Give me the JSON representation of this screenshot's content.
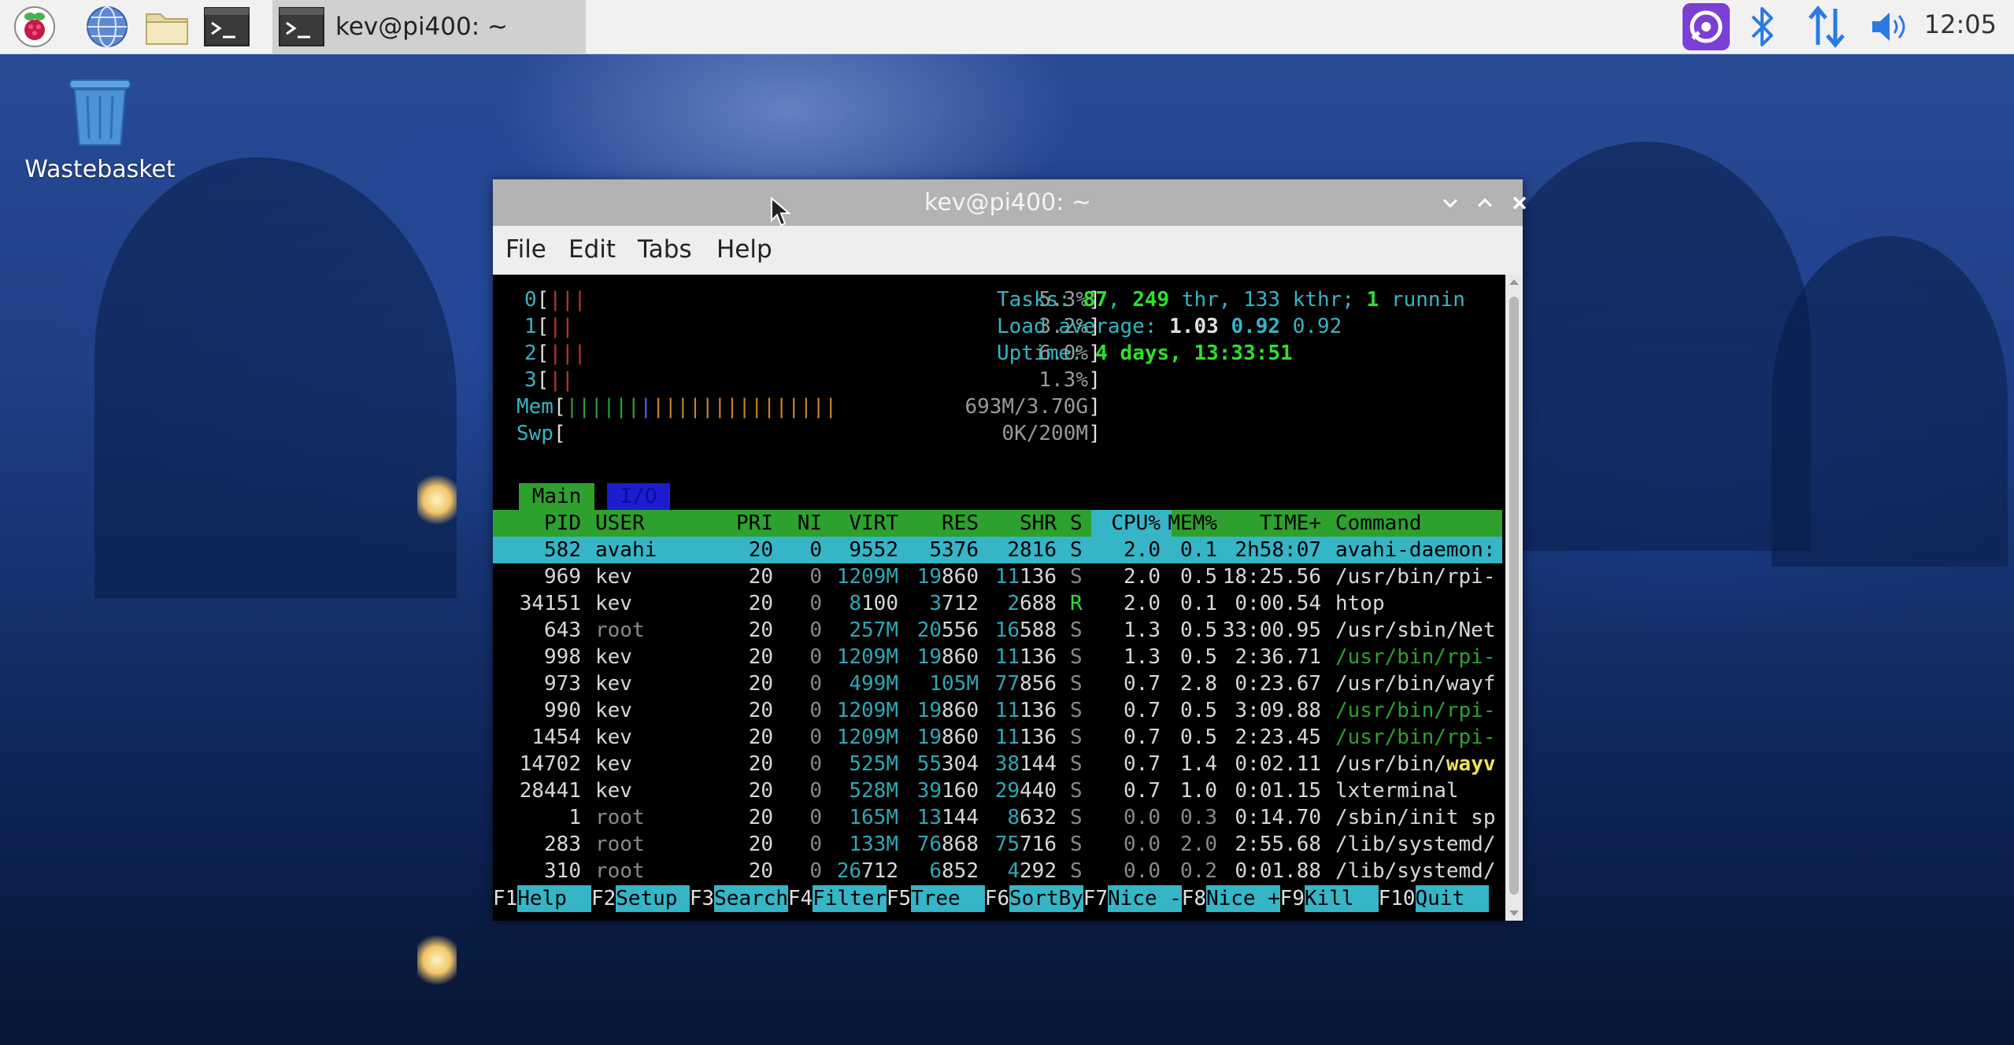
{
  "taskbar": {
    "launchers": [
      "raspberry-menu",
      "web-browser",
      "file-manager",
      "terminal"
    ],
    "task_title": "kev@pi400: ~",
    "clock": "12:05"
  },
  "desktop": {
    "wastebasket_label": "Wastebasket"
  },
  "window": {
    "title": "kev@pi400: ~",
    "menu": [
      "File",
      "Edit",
      "Tabs",
      "Help"
    ]
  },
  "htop": {
    "cpus": [
      {
        "label": "0",
        "bar": "|||",
        "pct": "5.3%"
      },
      {
        "label": "1",
        "bar": "||",
        "pct": "3.2%"
      },
      {
        "label": "2",
        "bar": "|||",
        "pct": "6.0%"
      },
      {
        "label": "3",
        "bar": "||",
        "pct": "1.3%"
      }
    ],
    "mem": {
      "label": "Mem",
      "value": "693M/3.70G"
    },
    "swp": {
      "label": "Swp",
      "value": "0K/200M"
    },
    "tasks": {
      "label": "Tasks:",
      "count": "87",
      "thr": "249",
      "thr_label": "thr,",
      "kthr": "133 kthr;",
      "running": "1",
      "running_label": "runnin"
    },
    "load": {
      "label": "Load average:",
      "v1": "1.03",
      "v5": "0.92",
      "v15": "0.92"
    },
    "uptime": {
      "label": "Uptime:",
      "value": "4 days, 13:33:51"
    },
    "tabs": {
      "main": "Main",
      "io": "I/O"
    },
    "headers": {
      "pid": "PID",
      "user": "USER",
      "pri": "PRI",
      "ni": "NI",
      "virt": "VIRT",
      "res": "RES",
      "shr": "SHR",
      "s": "S",
      "cpu": "CPU%",
      "mem": "MEM%",
      "time": "TIME+",
      "cmd": "Command"
    },
    "rows": [
      {
        "pid": "582",
        "user": "avahi",
        "pri": "20",
        "ni": "0",
        "virt": "9552",
        "res": "5376",
        "shr": "2816",
        "s": "S",
        "cpu": "2.0",
        "mem": "0.1",
        "time": "2h58:07",
        "cmd": "avahi-daemon:"
      },
      {
        "pid": "969",
        "user": "kev",
        "pri": "20",
        "ni": "0",
        "virt": "1209M",
        "res": "19860",
        "shr": "11136",
        "s": "S",
        "cpu": "2.0",
        "mem": "0.5",
        "time": "18:25.56",
        "cmd": "/usr/bin/rpi-"
      },
      {
        "pid": "34151",
        "user": "kev",
        "pri": "20",
        "ni": "0",
        "virt": "8100",
        "res": "3712",
        "shr": "2688",
        "s": "R",
        "cpu": "2.0",
        "mem": "0.1",
        "time": "0:00.54",
        "cmd": "htop"
      },
      {
        "pid": "643",
        "user": "root",
        "pri": "20",
        "ni": "0",
        "virt": "257M",
        "res": "20556",
        "shr": "16588",
        "s": "S",
        "cpu": "1.3",
        "mem": "0.5",
        "time": "33:00.95",
        "cmd": "/usr/sbin/Net"
      },
      {
        "pid": "998",
        "user": "kev",
        "pri": "20",
        "ni": "0",
        "virt": "1209M",
        "res": "19860",
        "shr": "11136",
        "s": "S",
        "cpu": "1.3",
        "mem": "0.5",
        "time": "2:36.71",
        "cmd": "/usr/bin/rpi-"
      },
      {
        "pid": "973",
        "user": "kev",
        "pri": "20",
        "ni": "0",
        "virt": "499M",
        "res": "105M",
        "shr": "77856",
        "s": "S",
        "cpu": "0.7",
        "mem": "2.8",
        "time": "0:23.67",
        "cmd": "/usr/bin/wayf"
      },
      {
        "pid": "990",
        "user": "kev",
        "pri": "20",
        "ni": "0",
        "virt": "1209M",
        "res": "19860",
        "shr": "11136",
        "s": "S",
        "cpu": "0.7",
        "mem": "0.5",
        "time": "3:09.88",
        "cmd": "/usr/bin/rpi-"
      },
      {
        "pid": "1454",
        "user": "kev",
        "pri": "20",
        "ni": "0",
        "virt": "1209M",
        "res": "19860",
        "shr": "11136",
        "s": "S",
        "cpu": "0.7",
        "mem": "0.5",
        "time": "2:23.45",
        "cmd": "/usr/bin/rpi-"
      },
      {
        "pid": "14702",
        "user": "kev",
        "pri": "20",
        "ni": "0",
        "virt": "525M",
        "res": "55304",
        "shr": "38144",
        "s": "S",
        "cpu": "0.7",
        "mem": "1.4",
        "time": "0:02.11",
        "cmd": "/usr/bin/wayv"
      },
      {
        "pid": "28441",
        "user": "kev",
        "pri": "20",
        "ni": "0",
        "virt": "528M",
        "res": "39160",
        "shr": "29440",
        "s": "S",
        "cpu": "0.7",
        "mem": "1.0",
        "time": "0:01.15",
        "cmd": "lxterminal"
      },
      {
        "pid": "1",
        "user": "root",
        "pri": "20",
        "ni": "0",
        "virt": "165M",
        "res": "13144",
        "shr": "8632",
        "s": "S",
        "cpu": "0.0",
        "mem": "0.3",
        "time": "0:14.70",
        "cmd": "/sbin/init sp"
      },
      {
        "pid": "283",
        "user": "root",
        "pri": "20",
        "ni": "0",
        "virt": "133M",
        "res": "76868",
        "shr": "75716",
        "s": "S",
        "cpu": "0.0",
        "mem": "2.0",
        "time": "2:55.68",
        "cmd": "/lib/systemd/"
      },
      {
        "pid": "310",
        "user": "root",
        "pri": "20",
        "ni": "0",
        "virt": "26712",
        "res": "6852",
        "shr": "4292",
        "s": "S",
        "cpu": "0.0",
        "mem": "0.2",
        "time": "0:01.88",
        "cmd": "/lib/systemd/"
      }
    ],
    "fkeys": [
      {
        "key": "F1",
        "label": "Help  "
      },
      {
        "key": "F2",
        "label": "Setup "
      },
      {
        "key": "F3",
        "label": "Search"
      },
      {
        "key": "F4",
        "label": "Filter"
      },
      {
        "key": "F5",
        "label": "Tree  "
      },
      {
        "key": "F6",
        "label": "SortBy"
      },
      {
        "key": "F7",
        "label": "Nice -"
      },
      {
        "key": "F8",
        "label": "Nice +"
      },
      {
        "key": "F9",
        "label": "Kill  "
      },
      {
        "key": "F10",
        "label": "Quit  "
      }
    ]
  },
  "colors": {
    "accent_green": "#2ea02e",
    "accent_cyan": "#35b5c6",
    "tray_purple": "#7b3fd3",
    "bluetooth": "#2a7be4"
  }
}
